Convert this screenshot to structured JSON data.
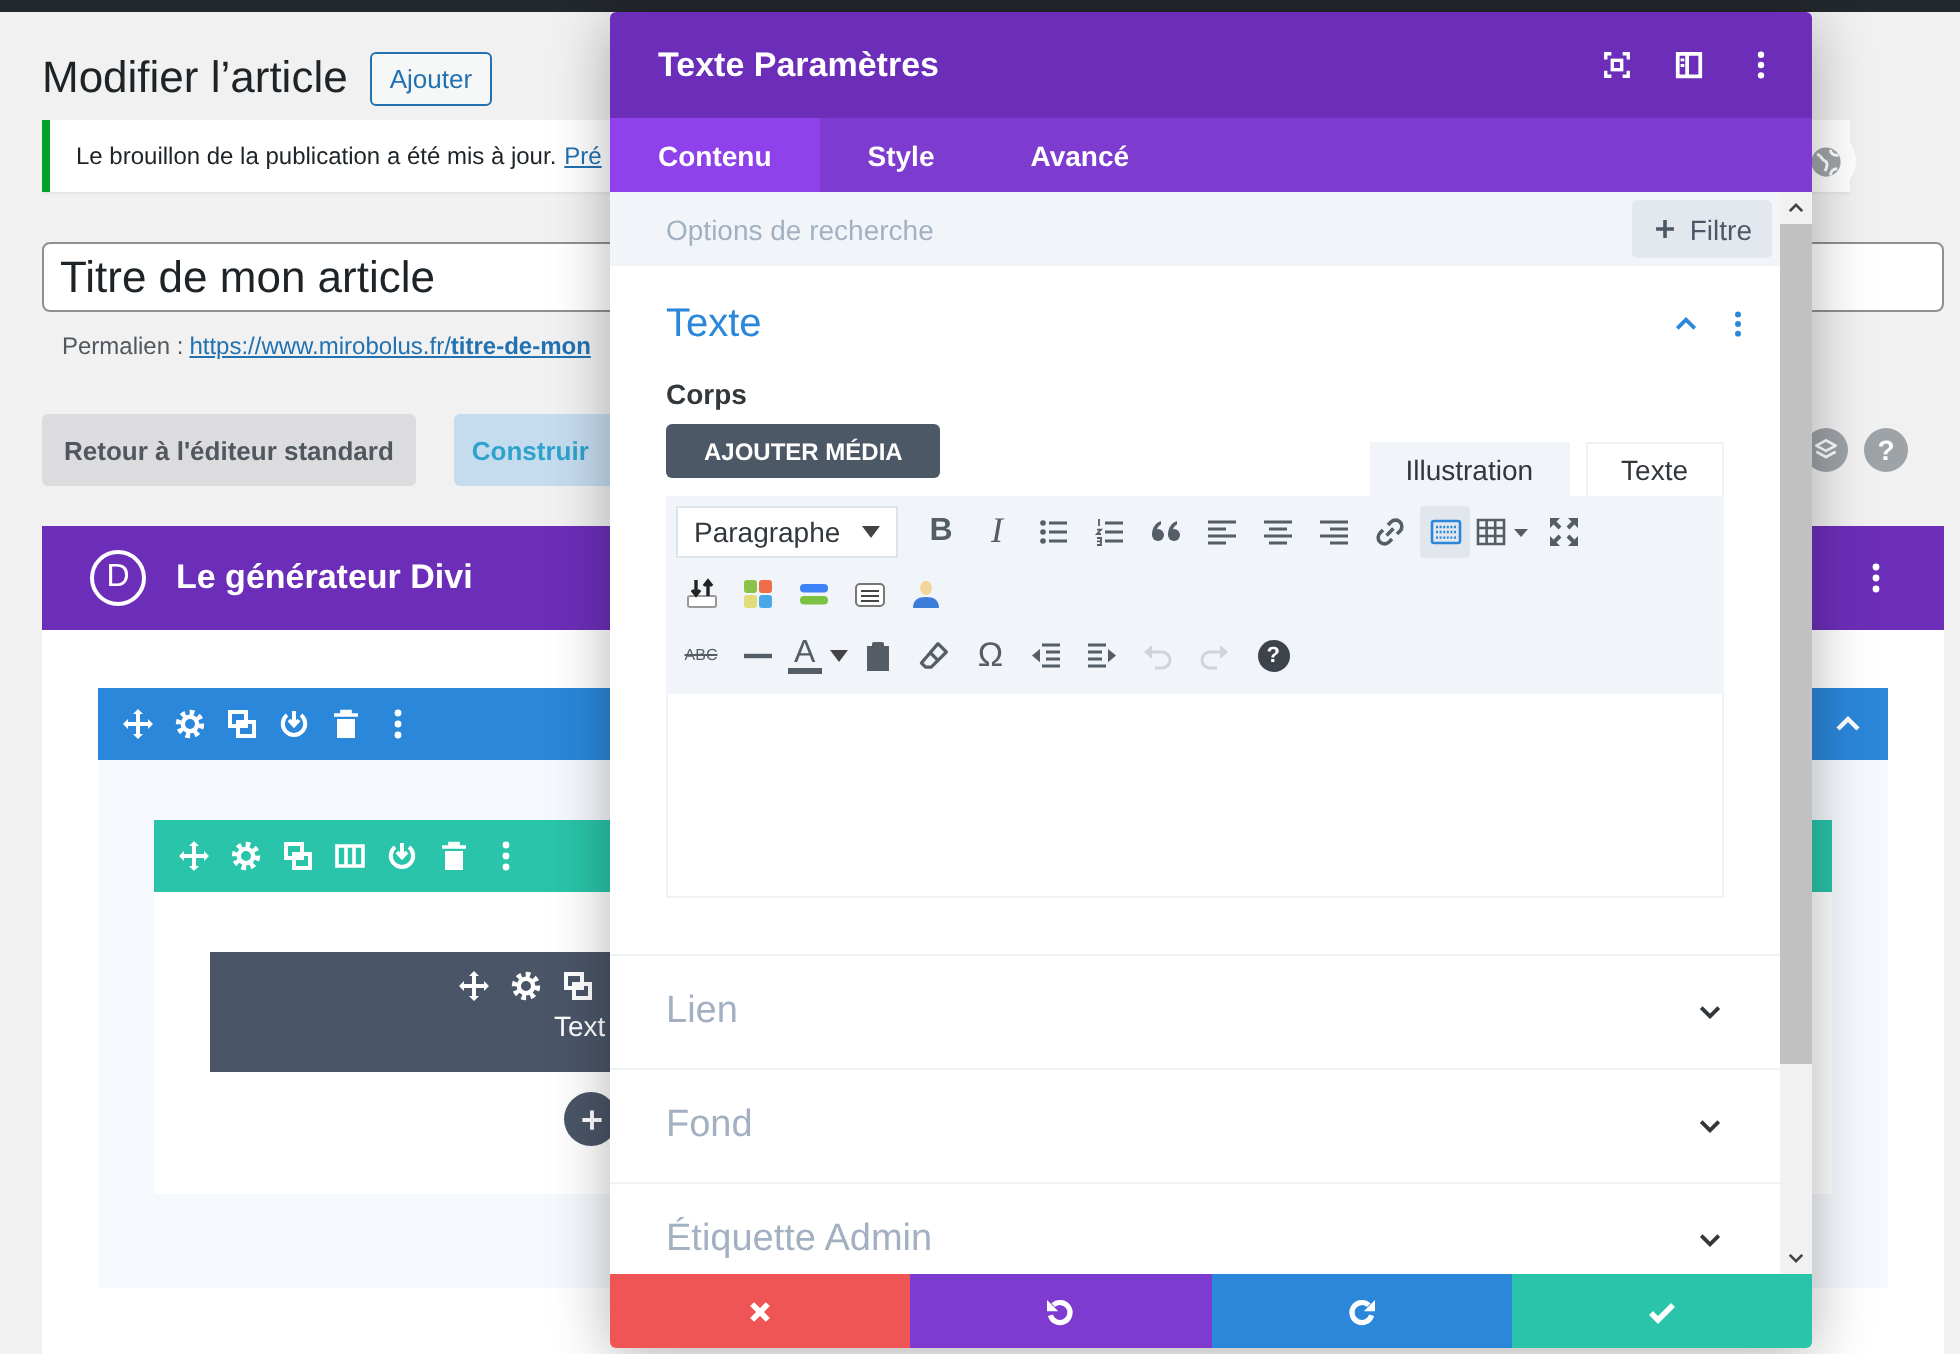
{
  "page": {
    "title": "Modifier l’article",
    "add_button": "Ajouter",
    "notice": {
      "text": "Le brouillon de la publication a été mis à jour.",
      "link": "Pré"
    },
    "post_title": "Titre de mon article",
    "permalink": {
      "label": "Permalien :",
      "url_base": "https://www.mirobolus.fr/",
      "url_slug": "titre-de-mon"
    },
    "buttons": [
      {
        "label": "Retour à l'éditeur standard",
        "kind": "secondary"
      },
      {
        "label": "Construir",
        "kind": "primary"
      }
    ],
    "help_button": "?"
  },
  "builder": {
    "logo_letter": "D",
    "title": "Le générateur Divi",
    "module_label": "Text"
  },
  "modal": {
    "title": "Texte Paramètres",
    "tabs": [
      {
        "label": "Contenu",
        "selected": true
      },
      {
        "label": "Style",
        "selected": false
      },
      {
        "label": "Avancé",
        "selected": false
      }
    ],
    "search": {
      "placeholder": "Options de recherche"
    },
    "filter_button": "Filtre",
    "sections": [
      {
        "title": "Texte",
        "expanded": true,
        "field_label": "Corps",
        "media_button": "AJOUTER MÉDIA",
        "editor_tabs": [
          {
            "label": "Illustration",
            "selected": true
          },
          {
            "label": "Texte",
            "selected": false
          }
        ],
        "toolbar": [
          [
            {
              "kind": "select",
              "label": "Paragraphe",
              "active": false,
              "disabled": false
            },
            {
              "kind": "bold",
              "label": "B",
              "active": false,
              "disabled": false
            },
            {
              "kind": "italic",
              "label": "I",
              "active": false,
              "disabled": false
            },
            {
              "kind": "bullet-list",
              "active": false,
              "disabled": false
            },
            {
              "kind": "numbered-list",
              "active": false,
              "disabled": false
            },
            {
              "kind": "quote",
              "active": false,
              "disabled": false
            },
            {
              "kind": "align-left",
              "active": false,
              "disabled": false
            },
            {
              "kind": "align-center",
              "active": false,
              "disabled": false
            },
            {
              "kind": "align-right",
              "active": false,
              "disabled": false
            },
            {
              "kind": "link",
              "active": false,
              "disabled": false
            },
            {
              "kind": "keyboard",
              "active": true,
              "disabled": false
            },
            {
              "kind": "table",
              "active": false,
              "disabled": false
            },
            {
              "kind": "fullscreen",
              "active": false,
              "disabled": false
            }
          ],
          [
            {
              "kind": "import",
              "active": false,
              "disabled": false
            },
            {
              "kind": "color-grid",
              "active": false,
              "disabled": false
            },
            {
              "kind": "bars",
              "active": false,
              "disabled": false
            },
            {
              "kind": "list-box",
              "active": false,
              "disabled": false
            },
            {
              "kind": "user",
              "active": false,
              "disabled": false
            }
          ],
          [
            {
              "kind": "strikethrough",
              "label": "ABC",
              "active": false,
              "disabled": false
            },
            {
              "kind": "horizontal-line",
              "active": false,
              "disabled": false
            },
            {
              "kind": "text-color",
              "label": "A",
              "active": false,
              "disabled": false
            },
            {
              "kind": "clipboard",
              "active": false,
              "disabled": false
            },
            {
              "kind": "eraser",
              "active": false,
              "disabled": false
            },
            {
              "kind": "special-character",
              "label": "Ω",
              "active": false,
              "disabled": false
            },
            {
              "kind": "outdent",
              "active": false,
              "disabled": false
            },
            {
              "kind": "indent",
              "active": false,
              "disabled": false
            },
            {
              "kind": "undo",
              "active": false,
              "disabled": true
            },
            {
              "kind": "redo",
              "active": false,
              "disabled": true
            },
            {
              "kind": "help",
              "label": "?",
              "active": false,
              "disabled": false
            }
          ]
        ]
      },
      {
        "title": "Lien",
        "expanded": false
      },
      {
        "title": "Fond",
        "expanded": false
      },
      {
        "title": "Étiquette Admin",
        "expanded": false
      }
    ]
  }
}
